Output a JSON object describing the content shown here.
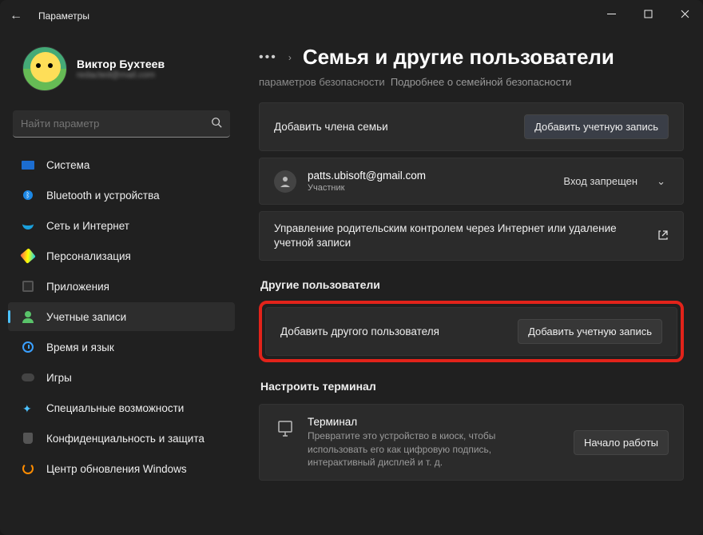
{
  "window": {
    "title": "Параметры"
  },
  "profile": {
    "name": "Виктор Бухтеев",
    "sub": "redacted@mail.com"
  },
  "search": {
    "placeholder": "Найти параметр"
  },
  "nav": {
    "system": "Система",
    "bluetooth": "Bluetooth и устройства",
    "network": "Сеть и Интернет",
    "personalization": "Персонализация",
    "apps": "Приложения",
    "accounts": "Учетные записи",
    "time": "Время и язык",
    "games": "Игры",
    "accessibility": "Специальные возможности",
    "privacy": "Конфиденциальность и защита",
    "update": "Центр обновления Windows"
  },
  "page": {
    "heading": "Семья и другие пользователи",
    "truncated_prefix": "параметров безопасности",
    "learn_more": "Подробнее о семейной безопасности",
    "add_family_label": "Добавить члена семьи",
    "add_account_btn": "Добавить учетную запись",
    "member": {
      "email": "patts.ubisoft@gmail.com",
      "role": "Участник",
      "status": "Вход запрещен"
    },
    "manage_parental": "Управление родительским контролем через Интернет или удаление учетной записи",
    "other_users_heading": "Другие пользователи",
    "add_other_label": "Добавить другого пользователя",
    "add_other_btn": "Добавить учетную запись",
    "kiosk_heading": "Настроить терминал",
    "kiosk_title": "Терминал",
    "kiosk_desc": "Превратите это устройство в киоск, чтобы использовать его как цифровую подпись, интерактивный дисплей и т. д.",
    "kiosk_btn": "Начало работы"
  }
}
